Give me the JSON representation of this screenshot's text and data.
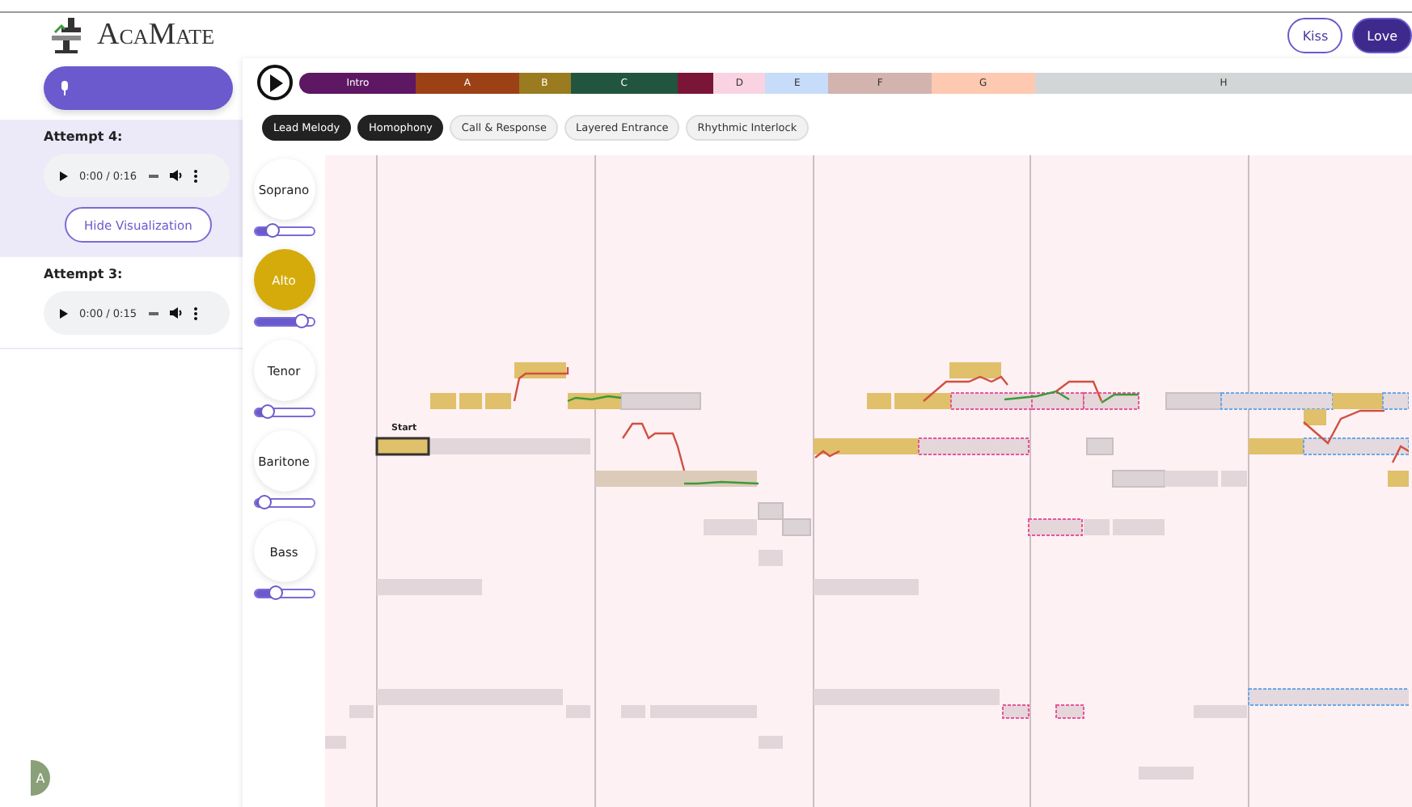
{
  "app": {
    "name": "AcaMate"
  },
  "header_buttons": [
    {
      "label": "Kiss",
      "selected": false
    },
    {
      "label": "Love",
      "selected": true
    }
  ],
  "attempts": [
    {
      "title": "Attempt 4:",
      "time": "0:00 / 0:16",
      "selected": true,
      "action": "Hide Visualization"
    },
    {
      "title": "Attempt 3:",
      "time": "0:00 / 0:15",
      "selected": false
    }
  ],
  "avatar": "A",
  "sections": [
    {
      "label": "Intro",
      "color": "#5e1763"
    },
    {
      "label": "A",
      "color": "#9c4116"
    },
    {
      "label": "B",
      "color": "#9a7b1f"
    },
    {
      "label": "C",
      "color": "#22553f"
    },
    {
      "color": "#7a1538"
    },
    {
      "label": "D",
      "color": "#fad3e2"
    },
    {
      "label": "E",
      "color": "#c6dcf8"
    },
    {
      "label": "F",
      "color": "#d2b3ae"
    },
    {
      "label": "G",
      "color": "#fdc9b0"
    },
    {
      "label": "H",
      "color": "#d3d6d6"
    }
  ],
  "arrangements": [
    {
      "label": "Lead Melody",
      "selected": true
    },
    {
      "label": "Homophony",
      "selected": true
    },
    {
      "label": "Call & Response",
      "selected": false
    },
    {
      "label": "Layered Entrance",
      "selected": false
    },
    {
      "label": "Rhythmic Interlock",
      "selected": false
    }
  ],
  "voices": [
    {
      "name": "Soprano",
      "selected": false,
      "level": 0.3
    },
    {
      "name": "Alto",
      "selected": true,
      "level": 0.8
    },
    {
      "name": "Tenor",
      "selected": false,
      "level": 0.2
    },
    {
      "name": "Baritone",
      "selected": false,
      "level": 0.15
    },
    {
      "name": "Bass",
      "selected": false,
      "level": 0.35
    }
  ],
  "roll": {
    "start_label": "Start"
  }
}
